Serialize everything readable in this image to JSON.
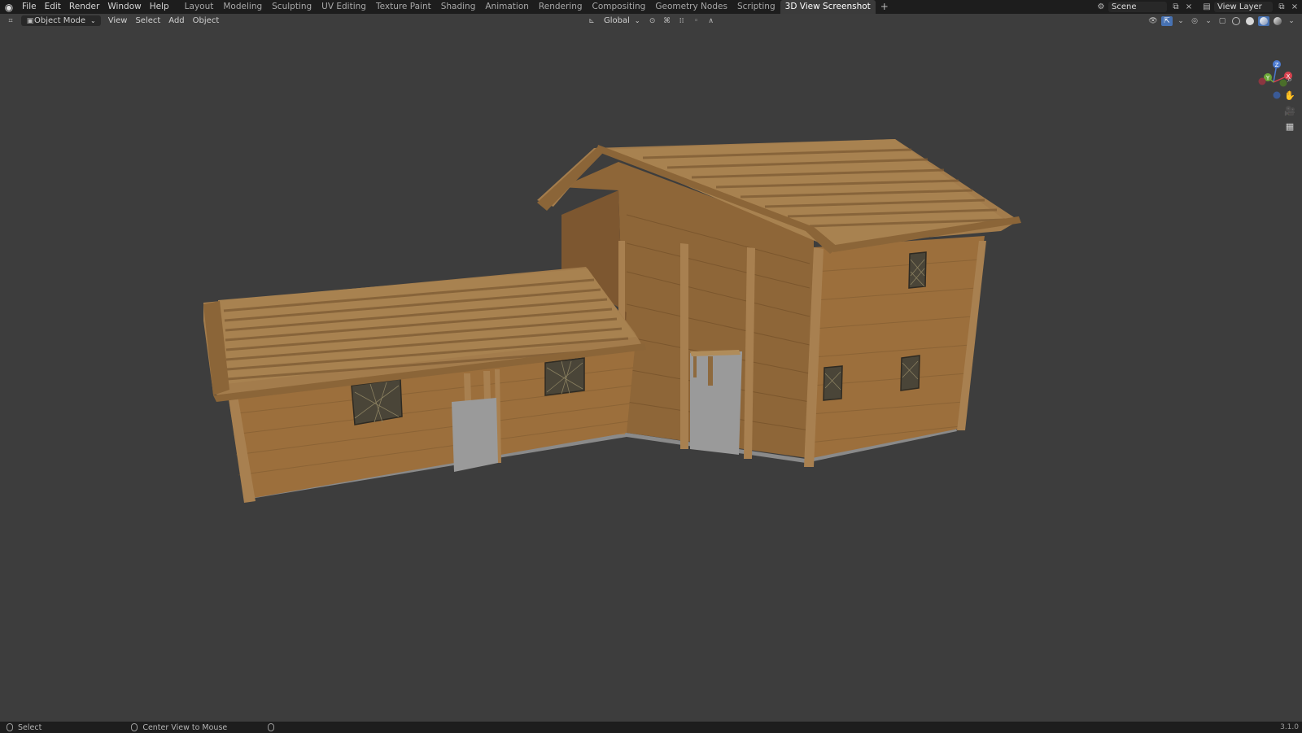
{
  "topbar": {
    "menu": [
      "File",
      "Edit",
      "Render",
      "Window",
      "Help"
    ],
    "tabs": [
      "Layout",
      "Modeling",
      "Sculpting",
      "UV Editing",
      "Texture Paint",
      "Shading",
      "Animation",
      "Rendering",
      "Compositing",
      "Geometry Nodes",
      "Scripting",
      "3D View Screenshot"
    ],
    "active_tab": "3D View Screenshot",
    "scene": "Scene",
    "view_layer": "View Layer"
  },
  "header": {
    "mode": "Object Mode",
    "menu": [
      "View",
      "Select",
      "Add",
      "Object"
    ],
    "transform_orientation": "Global"
  },
  "gizmo": {
    "z": "Z",
    "y": "Y",
    "x": "X"
  },
  "statusbar": {
    "select": "Select",
    "center_view": "Center View to Mouse",
    "version": "3.1.0"
  },
  "colors": {
    "wood": "#9b6e3e",
    "wood_dark": "#7a5530",
    "roof": "#a07a4c",
    "background": "#3d3d3d",
    "accent": "#4772b3"
  }
}
